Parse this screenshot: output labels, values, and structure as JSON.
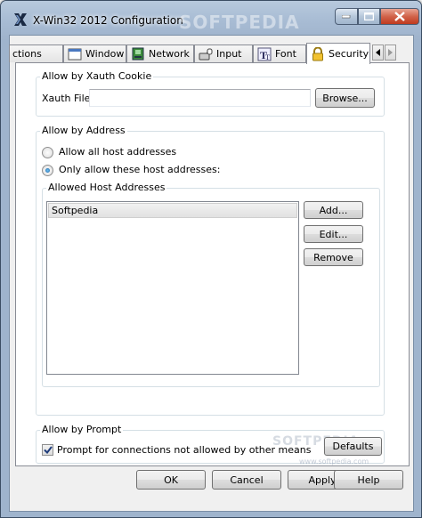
{
  "window": {
    "title": "X-Win32 2012 Configuration",
    "watermark": "SOFTPEDIA"
  },
  "tabs": [
    {
      "label": "ctions",
      "icon": "none"
    },
    {
      "label": "Window",
      "icon": "window-icon"
    },
    {
      "label": "Network",
      "icon": "network-icon"
    },
    {
      "label": "Input",
      "icon": "input-icon"
    },
    {
      "label": "Font",
      "icon": "font-icon"
    },
    {
      "label": "Security",
      "icon": "lock-icon",
      "active": true
    }
  ],
  "xauth": {
    "group_label": "Allow by Xauth Cookie",
    "file_label": "Xauth File:",
    "file_value": "",
    "browse_label": "Browse..."
  },
  "address": {
    "group_label": "Allow by Address",
    "option_all": "Allow all host addresses",
    "option_only": "Only allow these host addresses:",
    "selected": "only",
    "hosts_group_label": "Allowed Host Addresses",
    "hosts": [
      "Softpedia"
    ],
    "add_label": "Add...",
    "edit_label": "Edit...",
    "remove_label": "Remove"
  },
  "prompt": {
    "group_label": "Allow by Prompt",
    "checkbox_label": "Prompt for connections not allowed by other means",
    "checked": true
  },
  "defaults_label": "Defaults",
  "footer": {
    "ok": "OK",
    "cancel": "Cancel",
    "apply": "Apply",
    "help": "Help",
    "watermark_url": "www.softpedia.com"
  },
  "colors": {
    "titlebar": "#a8bcd4",
    "close_button": "#c9462c",
    "panel_bg": "#ffffff",
    "dialog_bg": "#f0f0f0"
  }
}
